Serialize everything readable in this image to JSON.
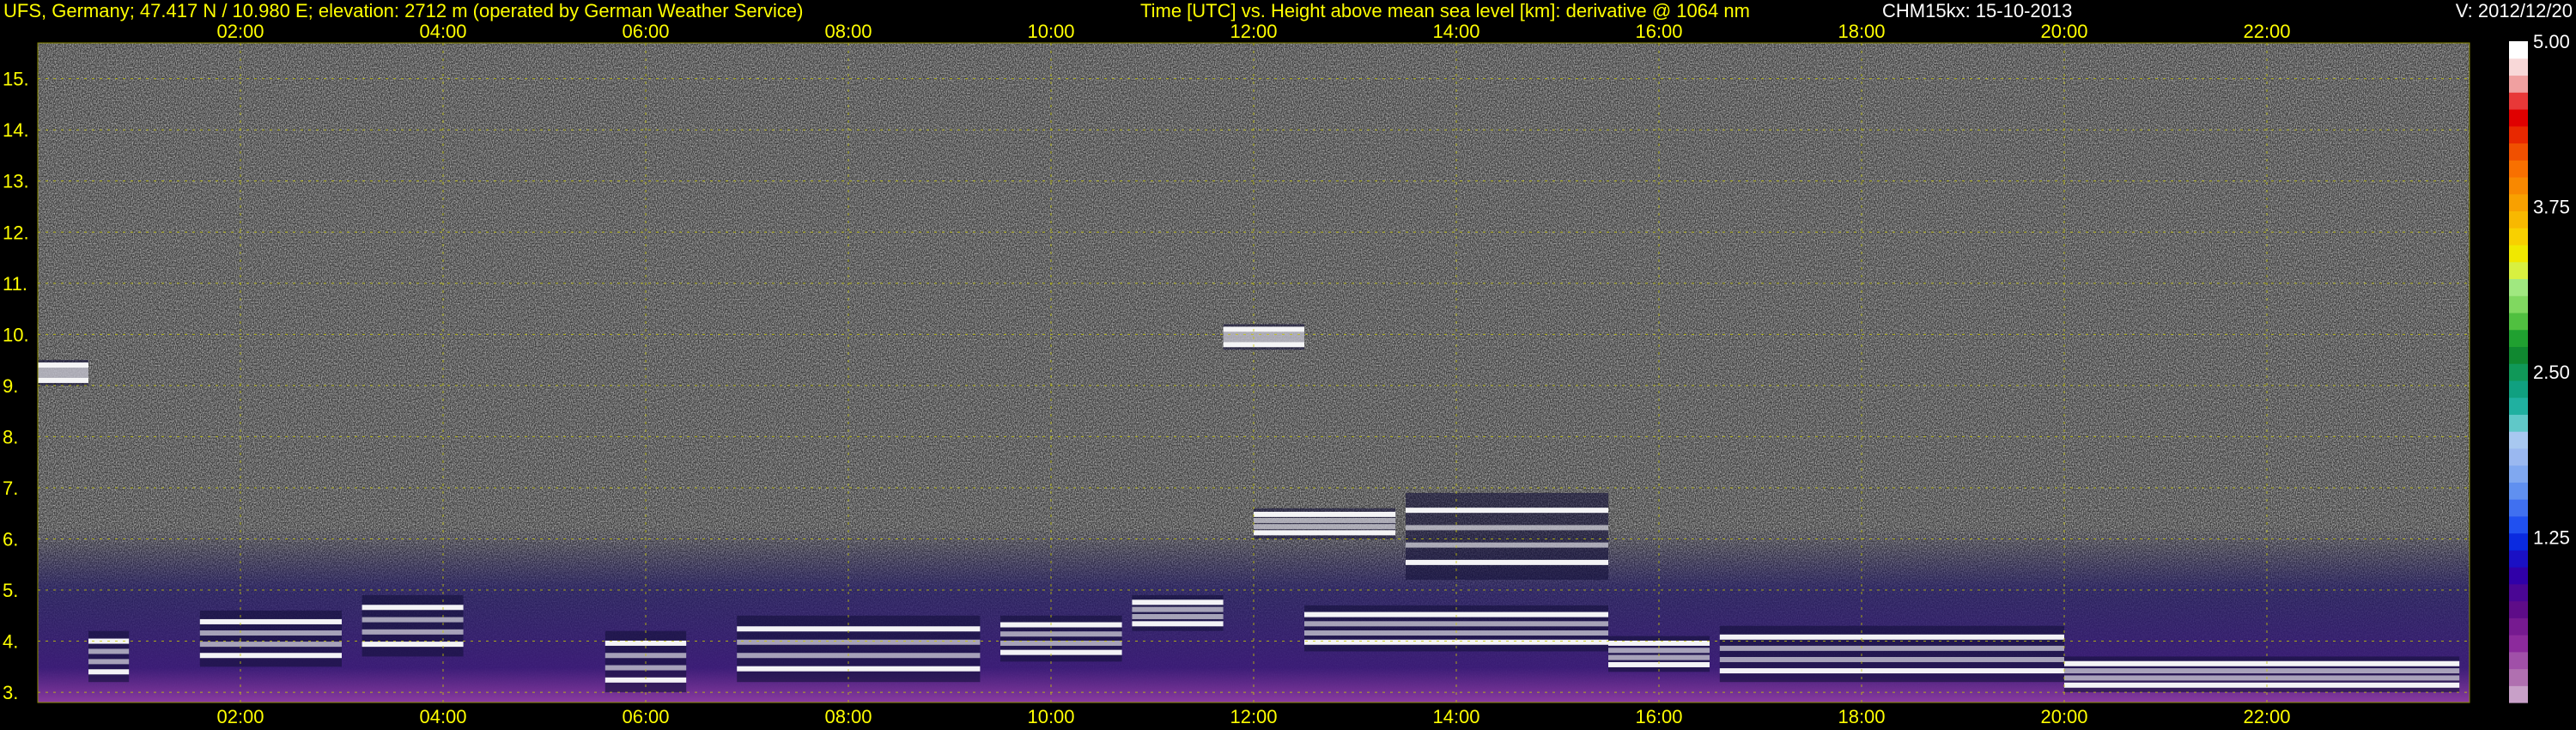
{
  "header": {
    "station": "UFS, Germany; 47.417 N / 10.980 E; elevation: 2712 m  (operated by German Weather Service)",
    "description": "Time [UTC] vs. Height above mean sea level [km]: derivative @ 1064 nm",
    "instrument": "CHM15kx: 15-10-2013",
    "version": "V: 2012/12/20"
  },
  "chart_data": {
    "type": "heatmap",
    "x_axis": {
      "label": "Time [UTC]",
      "range_hours": [
        0,
        24
      ],
      "ticks": [
        "02:00",
        "04:00",
        "06:00",
        "08:00",
        "10:00",
        "12:00",
        "14:00",
        "16:00",
        "18:00",
        "20:00",
        "22:00"
      ],
      "tick_hours": [
        2,
        4,
        6,
        8,
        10,
        12,
        14,
        16,
        18,
        20,
        22
      ]
    },
    "y_axis": {
      "label": "Height above mean sea level [km]",
      "range_km": [
        2.8,
        15.7
      ],
      "ticks": [
        "3.",
        "4.",
        "5.",
        "6.",
        "7.",
        "8.",
        "9.",
        "10.",
        "11.",
        "12.",
        "13.",
        "14.",
        "15."
      ],
      "tick_values": [
        3,
        4,
        5,
        6,
        7,
        8,
        9,
        10,
        11,
        12,
        13,
        14,
        15
      ]
    },
    "colorbar": {
      "range": [
        0,
        5
      ],
      "labels": [
        "1.25",
        "2.50",
        "3.75",
        "5.00"
      ],
      "label_values": [
        1.25,
        2.5,
        3.75,
        5.0
      ],
      "colors": [
        "#c8a0c8",
        "#b070b0",
        "#a050a8",
        "#8c2a9c",
        "#761a90",
        "#5e0c88",
        "#4a0694",
        "#3000a8",
        "#1a10c4",
        "#0a2ae0",
        "#2050f0",
        "#4070f0",
        "#6090f0",
        "#80a8f0",
        "#9ab8f0",
        "#a8c8f0",
        "#60c8c8",
        "#20b0a0",
        "#10a080",
        "#109858",
        "#108830",
        "#20a030",
        "#50c040",
        "#80d860",
        "#a0e880",
        "#d8f040",
        "#f0e800",
        "#f8d000",
        "#f8b800",
        "#f8a000",
        "#f88800",
        "#f87000",
        "#f05000",
        "#e82800",
        "#e00000",
        "#e83838",
        "#f0a0a0",
        "#f8d8d8",
        "#ffffff"
      ]
    },
    "layers": [
      {
        "start_h": 0.0,
        "end_h": 0.5,
        "bottom_km": 9.0,
        "top_km": 9.5
      },
      {
        "start_h": 0.5,
        "end_h": 0.9,
        "bottom_km": 3.2,
        "top_km": 4.2
      },
      {
        "start_h": 1.6,
        "end_h": 3.0,
        "bottom_km": 3.5,
        "top_km": 4.6
      },
      {
        "start_h": 3.2,
        "end_h": 4.2,
        "bottom_km": 3.7,
        "top_km": 4.9
      },
      {
        "start_h": 5.6,
        "end_h": 6.4,
        "bottom_km": 3.0,
        "top_km": 4.2
      },
      {
        "start_h": 6.9,
        "end_h": 9.3,
        "bottom_km": 3.2,
        "top_km": 4.5
      },
      {
        "start_h": 9.5,
        "end_h": 10.7,
        "bottom_km": 3.6,
        "top_km": 4.5
      },
      {
        "start_h": 10.8,
        "end_h": 11.7,
        "bottom_km": 4.2,
        "top_km": 4.9
      },
      {
        "start_h": 11.7,
        "end_h": 12.5,
        "bottom_km": 9.7,
        "top_km": 10.2
      },
      {
        "start_h": 12.0,
        "end_h": 13.4,
        "bottom_km": 6.0,
        "top_km": 6.6
      },
      {
        "start_h": 12.5,
        "end_h": 15.5,
        "bottom_km": 3.8,
        "top_km": 4.7
      },
      {
        "start_h": 13.5,
        "end_h": 15.5,
        "bottom_km": 5.2,
        "top_km": 6.9
      },
      {
        "start_h": 15.5,
        "end_h": 16.5,
        "bottom_km": 3.4,
        "top_km": 4.1
      },
      {
        "start_h": 16.6,
        "end_h": 20.0,
        "bottom_km": 3.2,
        "top_km": 4.3
      },
      {
        "start_h": 20.0,
        "end_h": 23.9,
        "bottom_km": 3.0,
        "top_km": 3.7
      }
    ]
  }
}
